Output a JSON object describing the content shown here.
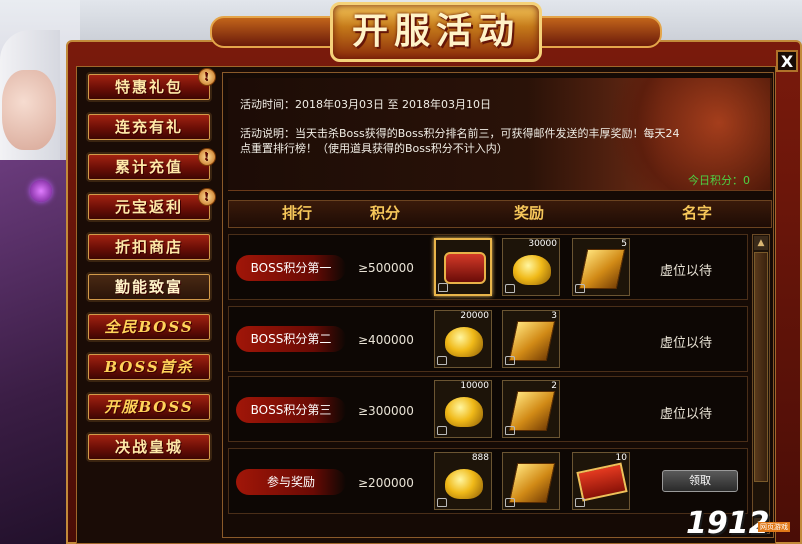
{
  "banner": {
    "title": "开服活动"
  },
  "close_label": "X",
  "sidebar": {
    "items": [
      {
        "label": "特惠礼包",
        "badge": "!"
      },
      {
        "label": "连充有礼",
        "badge": ""
      },
      {
        "label": "累计充值",
        "badge": "!"
      },
      {
        "label": "元宝返利",
        "badge": "!"
      },
      {
        "label": "折扣商店",
        "badge": ""
      },
      {
        "label": "勤能致富",
        "badge": ""
      },
      {
        "label": "全民BOSS",
        "badge": ""
      },
      {
        "label": "BOSS首杀",
        "badge": ""
      },
      {
        "label": "开服BOSS",
        "badge": ""
      },
      {
        "label": "决战皇城",
        "badge": ""
      }
    ],
    "active_index": 5
  },
  "info": {
    "time_line": "活动时间：2018年03月03日 至 2018年03月10日",
    "desc_line1": "活动说明：当天击杀Boss获得的Boss积分排名前三，可获得邮件发送的丰厚奖励！每天24",
    "desc_line2": "点重置排行榜！（使用道具获得的Boss积分不计入内）",
    "today_score": "今日积分：0"
  },
  "table": {
    "headers": {
      "rank": "排行",
      "score": "积分",
      "reward": "奖励",
      "name": "名字"
    },
    "rows": [
      {
        "rank": "BOSS积分第一",
        "score": "≥500000",
        "name": "虚位以待",
        "rewards": [
          {
            "icon": "treasure-chest-icon",
            "count": ""
          },
          {
            "icon": "gold-ingot-icon",
            "count": "30000"
          },
          {
            "icon": "gold-bar-icon",
            "count": "5"
          }
        ]
      },
      {
        "rank": "BOSS积分第二",
        "score": "≥400000",
        "name": "虚位以待",
        "rewards": [
          {
            "icon": "gold-ingot-icon",
            "count": "20000"
          },
          {
            "icon": "gold-bar-icon",
            "count": "3"
          }
        ]
      },
      {
        "rank": "BOSS积分第三",
        "score": "≥300000",
        "name": "虚位以待",
        "rewards": [
          {
            "icon": "gold-ingot-icon",
            "count": "10000"
          },
          {
            "icon": "gold-bar-icon",
            "count": "2"
          }
        ]
      },
      {
        "rank": "参与奖励",
        "score": "≥200000",
        "name": "",
        "rewards": [
          {
            "icon": "gold-ingot-icon",
            "count": "888"
          },
          {
            "icon": "gold-bar-icon",
            "count": ""
          },
          {
            "icon": "red-ticket-icon",
            "count": "10"
          }
        ]
      }
    ],
    "claim_label": "领取"
  },
  "logo": {
    "text": "1912",
    "sub": "网页游戏"
  }
}
